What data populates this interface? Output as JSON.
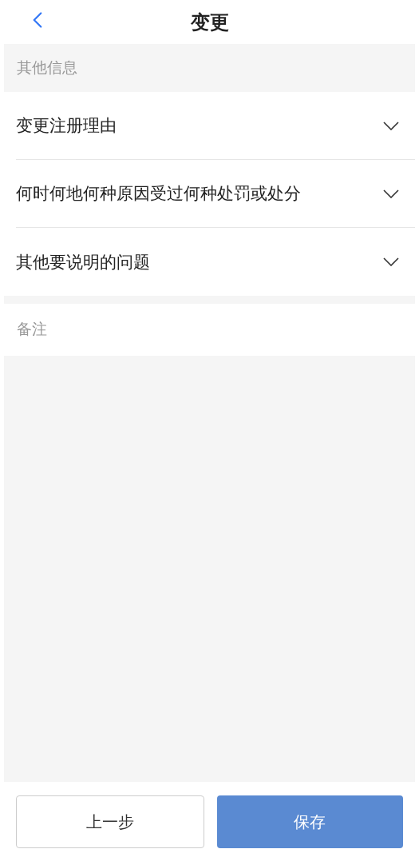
{
  "header": {
    "title": "变更"
  },
  "section_label": "其他信息",
  "items": [
    {
      "label": "变更注册理由",
      "expanded": false
    },
    {
      "label": "何时何地何种原因受过何种处罚或处分",
      "expanded": false
    },
    {
      "label": "其他要说明的问题",
      "expanded": false
    }
  ],
  "remarks": {
    "label": "备注"
  },
  "buttons": [
    {
      "label": "上一步",
      "kind": "secondary"
    },
    {
      "label": "保存",
      "kind": "primary"
    }
  ]
}
